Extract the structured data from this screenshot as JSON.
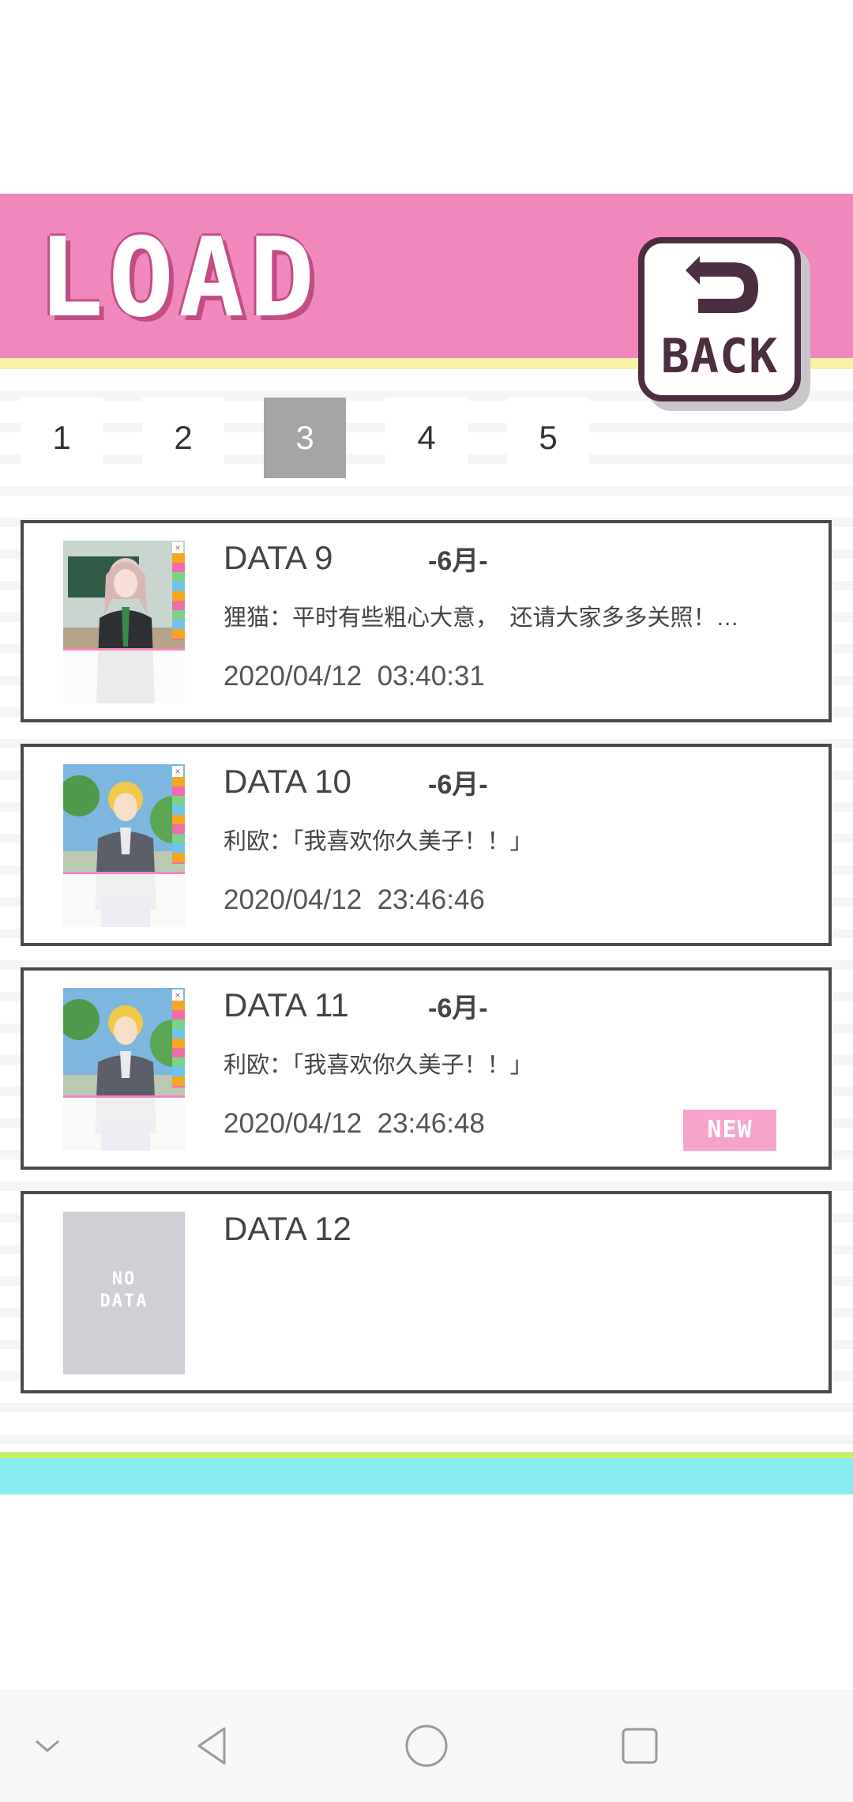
{
  "header": {
    "title": "LOAD",
    "back_label": "BACK",
    "colors": {
      "band": "#f087bd",
      "accent_stripe": "#f6f3a6",
      "back_border": "#4b2e3f"
    }
  },
  "page_tabs": {
    "items": [
      "1",
      "2",
      "3",
      "4",
      "5"
    ],
    "active": "3"
  },
  "slots": [
    {
      "title": "DATA 9",
      "chapter": "-6月-",
      "text": "狸猫：平时有些粗心大意，　还请大家多多关照！…",
      "date": "2020/04/12",
      "time": "03:40:31",
      "thumbnail": "classroom-character-scene"
    },
    {
      "title": "DATA 10",
      "chapter": "-6月-",
      "text": "利欧：「我喜欢你久美子！！」",
      "date": "2020/04/12",
      "time": "23:46:46",
      "thumbnail": "outdoor-character-scene"
    },
    {
      "title": "DATA 11",
      "chapter": "-6月-",
      "text": "利欧：「我喜欢你久美子！！」",
      "date": "2020/04/12",
      "time": "23:46:48",
      "thumbnail": "outdoor-character-scene",
      "badge": "NEW"
    },
    {
      "title": "DATA 12",
      "empty_line1": "NO",
      "empty_line2": "DATA"
    }
  ],
  "bottom_stripe_colors": {
    "lime": "#c6f06a",
    "cyan": "#86ecf0"
  },
  "system_nav": {
    "icons": [
      "chevron-down-icon",
      "back-triangle-icon",
      "home-circle-icon",
      "recents-square-icon"
    ]
  }
}
